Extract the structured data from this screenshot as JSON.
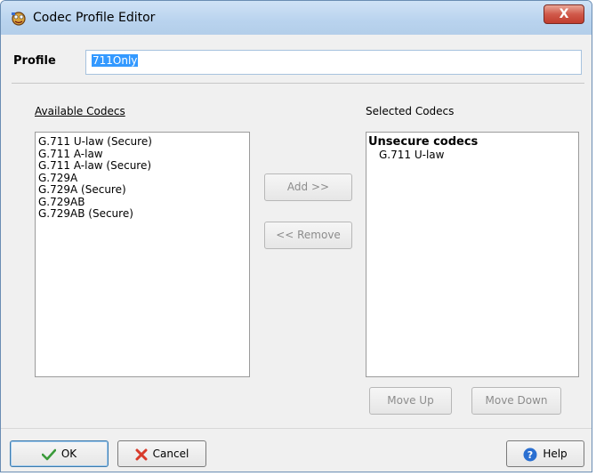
{
  "window": {
    "title": "Codec Profile Editor",
    "close_glyph": "X"
  },
  "profile": {
    "label": "Profile",
    "value": "711Only"
  },
  "available": {
    "label": "Available Codecs",
    "items": [
      "G.711 U-law (Secure)",
      "G.711 A-law",
      "G.711 A-law (Secure)",
      "G.729A",
      "G.729A (Secure)",
      "G.729AB",
      "G.729AB (Secure)"
    ]
  },
  "selected": {
    "label": "Selected Codecs",
    "group_header": "Unsecure codecs",
    "items": [
      "G.711 U-law"
    ]
  },
  "buttons": {
    "add": "Add >>",
    "remove": "<< Remove",
    "move_up": "Move Up",
    "move_down": "Move Down",
    "ok": "OK",
    "cancel": "Cancel",
    "help": "Help"
  },
  "colors": {
    "selection": "#3399ff",
    "disabled_text": "#8c8c8c",
    "ok_check": "#3a9a3a",
    "cancel_x": "#d83a2a",
    "help_blue": "#2a6fd1"
  }
}
